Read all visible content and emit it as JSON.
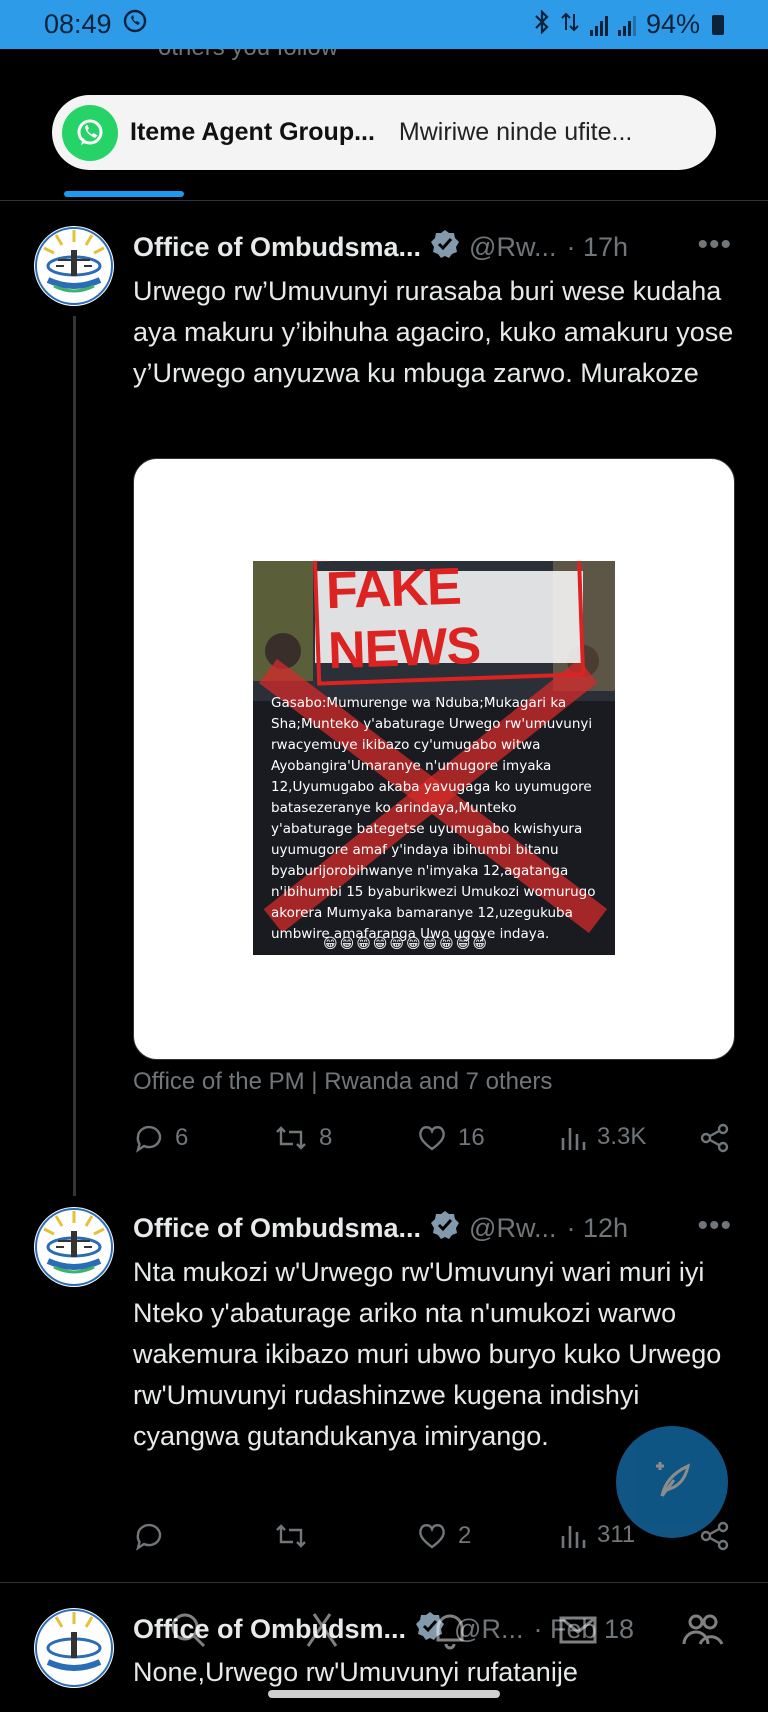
{
  "status_bar": {
    "time": "08:49",
    "battery": "94%",
    "icons": [
      "whatsapp-status-icon",
      "bluetooth-icon",
      "data-arrows-icon",
      "signal-icon",
      "signal-icon",
      "battery-icon"
    ]
  },
  "peek_text": "others you follow",
  "notification": {
    "app_icon": "whatsapp-icon",
    "title": "Iteme Agent Group...",
    "message": "Mwiriwe ninde ufite..."
  },
  "colors": {
    "accent": "#1d9bf0",
    "status_bar": "#2d9be8",
    "whatsapp": "#25d366",
    "muted": "#71767b",
    "background": "#000000"
  },
  "tweets": [
    {
      "name": "Office of Ombudsma...",
      "handle": "@Rw...",
      "time": "· 17h",
      "body": "Urwego rw’Umuvunyi rurasaba buri wese kudaha aya makuru y’ibihuha agaciro, kuko amakuru yose y’Urwego anyuzwa ku mbuga zarwo. Murakoze",
      "media": {
        "banner": "FAKE NEWS",
        "text": "Gasabo:Mumurenge wa Nduba;Mukagari ka Sha;Munteko y'abaturage Urwego rw'umuvunyi rwacyemuye ikibazo cy'umugabo witwa Ayobangira'Umaranye n'umugore imyaka 12,Uyumugabo akaba yavugaga ko uyumugore batasezeranye ko arindaya,Munteko y'abaturage bategetse uyumugabo kwishyura uyumugore amaf y'indaya ibihumbi bitanu byaburijorobihwanye n'imyaka 12,agatanga n'ibihumbi 15 byaburikwezi Umukozi womurugo akorera Mumyaka bamaranye 12,uzegukuba umbwire amafaranga Uwo ugoye indaya.",
        "emojis": "😁😁😁😁😁😁😁😁😁😁"
      },
      "tagline": "Office of the PM | Rwanda and 7 others",
      "stats": {
        "replies": "6",
        "reposts": "8",
        "likes": "16",
        "views": "3.3K"
      }
    },
    {
      "name": "Office of Ombudsma...",
      "handle": "@Rw...",
      "time": "· 12h",
      "body": "Nta mukozi w'Urwego rw'Umuvunyi wari muri iyi Nteko y'abaturage ariko  nta n'umukozi warwo wakemura ikibazo muri ubwo buryo kuko Urwego rw'Umuvunyi rudashinzwe kugena indishyi cyangwa gutandukanya imiryango.",
      "stats": {
        "replies": "",
        "reposts": "",
        "likes": "2",
        "views": "311"
      }
    },
    {
      "name": "Office of Ombudsm...",
      "handle": "@R...",
      "time": "· Feb 18",
      "body": "None,Urwego rw'Umuvunyi rufatanije"
    }
  ]
}
